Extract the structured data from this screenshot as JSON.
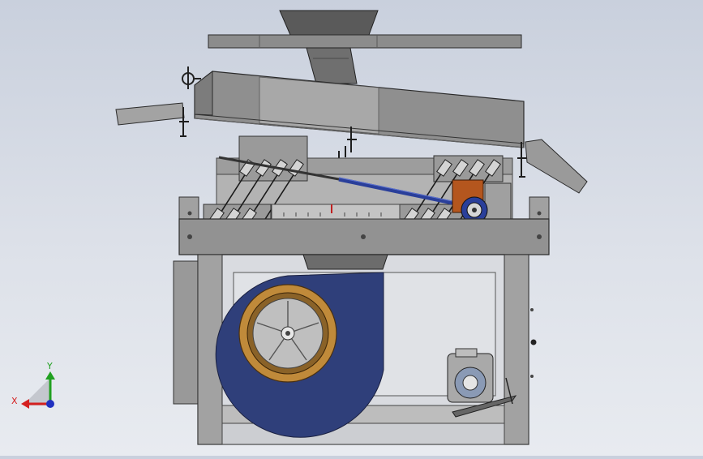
{
  "viewport": {
    "background_top": "#c9d0dd",
    "background_bottom": "#e8ebf0"
  },
  "palette": {
    "frame_gray": "#8a8a8a",
    "panel_gray": "#a4a4a4",
    "dark_edge": "#2e2e2e",
    "fan_blue": "#2f3f7a",
    "fan_gold": "#c08a3a",
    "motor_orange": "#b4561e",
    "link_blue": "#2a3f9a"
  },
  "triad": {
    "x_label": "X",
    "y_label": "Y",
    "x_color": "#d42020",
    "y_color": "#20a020",
    "z_color": "#2030c0"
  },
  "components": [
    "feed-hopper",
    "top-plate",
    "vibrating-trough",
    "discharge-chute-left",
    "discharge-chute-right",
    "spring-support-left",
    "spring-support-right",
    "connecting-rod",
    "eccentric-drive",
    "base-frame-beam",
    "cabinet-frame",
    "centrifugal-fan",
    "electric-motor"
  ]
}
